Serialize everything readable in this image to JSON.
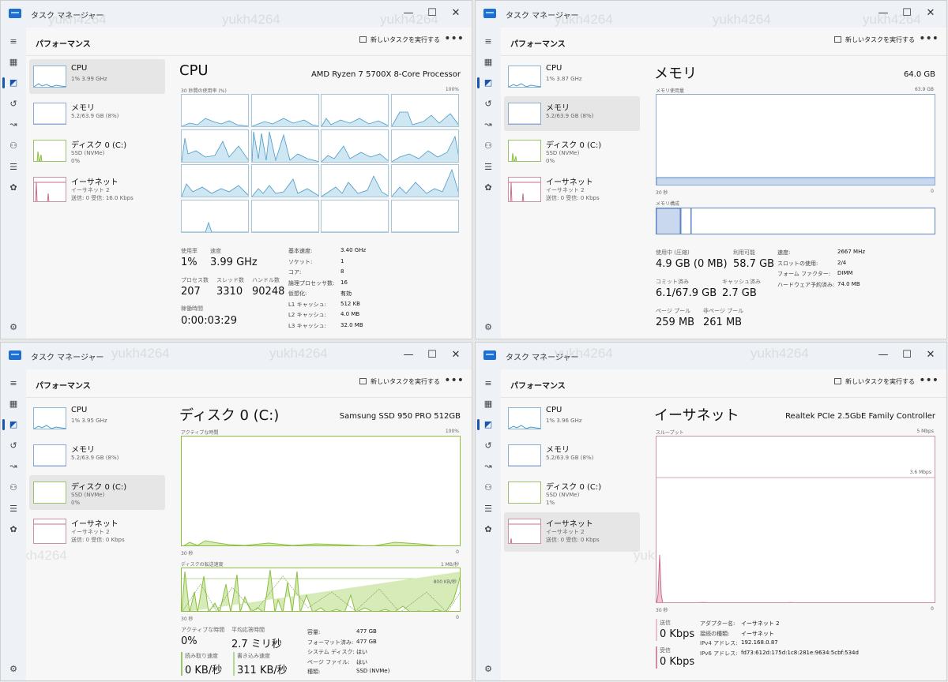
{
  "app_title": "タスク マネージャー",
  "page_title": "パフォーマンス",
  "run_task": "新しいタスクを実行する",
  "more": "•••",
  "window_controls": {
    "min": "—",
    "max": "☐",
    "close": "✕"
  },
  "watermark": "yukh4264",
  "colors": {
    "cpu": "#4a9ac8",
    "mem": "#5c86c4",
    "disk": "#8cbf3e",
    "net": "#c86b8a",
    "accent": "#1a56b0"
  },
  "rail_icons": [
    "hamburger-icon",
    "processes-icon",
    "performance-icon",
    "history-icon",
    "startup-icon",
    "users-icon",
    "details-icon",
    "services-icon",
    "settings-icon"
  ],
  "windows": [
    {
      "sidebar": [
        {
          "name": "CPU",
          "sub1": "1%  3.99 GHz",
          "sub2": "",
          "sub3": ""
        },
        {
          "name": "メモリ",
          "sub1": "5.2/63.9 GB (8%)",
          "sub2": "",
          "sub3": ""
        },
        {
          "name": "ディスク 0 (C:)",
          "sub1": "SSD (NVMe)",
          "sub2": "0%",
          "sub3": ""
        },
        {
          "name": "イーサネット",
          "sub1": "イーサネット 2",
          "sub2": "送信: 0  受信: 16.0 Kbps",
          "sub3": ""
        }
      ],
      "title": "CPU",
      "model": "AMD Ryzen 7 5700X 8-Core Processor",
      "graph_caption_left": "30 秒間の使用率 (%)",
      "graph_caption_right": "100%",
      "stats": {
        "usage_label": "使用率",
        "usage": "1%",
        "speed_label": "速度",
        "speed": "3.99 GHz",
        "proc_label": "プロセス数",
        "proc": "207",
        "thread_label": "スレッド数",
        "thread": "3310",
        "handle_label": "ハンドル数",
        "handle": "90248",
        "uptime_label": "稼働時間",
        "uptime": "0:00:03:29"
      },
      "kv": [
        {
          "k": "基本速度:",
          "v": "3.40 GHz"
        },
        {
          "k": "ソケット:",
          "v": "1"
        },
        {
          "k": "コア:",
          "v": "8"
        },
        {
          "k": "論理プロセッサ数:",
          "v": "16"
        },
        {
          "k": "仮想化:",
          "v": "有効"
        },
        {
          "k": "L1 キャッシュ:",
          "v": "512 KB"
        },
        {
          "k": "L2 キャッシュ:",
          "v": "4.0 MB"
        },
        {
          "k": "L3 キャッシュ:",
          "v": "32.0 MB"
        }
      ]
    },
    {
      "sidebar": [
        {
          "name": "CPU",
          "sub1": "1%  3.87 GHz",
          "sub2": "",
          "sub3": ""
        },
        {
          "name": "メモリ",
          "sub1": "5.2/63.9 GB (8%)",
          "sub2": "",
          "sub3": ""
        },
        {
          "name": "ディスク 0 (C:)",
          "sub1": "SSD (NVMe)",
          "sub2": "0%",
          "sub3": ""
        },
        {
          "name": "イーサネット",
          "sub1": "イーサネット 2",
          "sub2": "送信: 0  受信: 0 Kbps",
          "sub3": ""
        }
      ],
      "title": "メモリ",
      "model": "64.0 GB",
      "graph_caption_left": "メモリ使用量",
      "graph_caption_right": "63.9 GB",
      "axis_left": "30 秒",
      "axis_right": "0",
      "composition_label": "メモリ構成",
      "stats": {
        "inuse_label": "使用中 (圧縮)",
        "inuse": "4.9 GB (0 MB)",
        "avail_label": "利用可能",
        "avail": "58.7 GB",
        "commit_label": "コミット済み",
        "commit": "6.1/67.9 GB",
        "cached_label": "キャッシュ済み",
        "cached": "2.7 GB",
        "paged_label": "ページ プール",
        "paged": "259 MB",
        "nonpaged_label": "非ページ プール",
        "nonpaged": "261 MB"
      },
      "kv": [
        {
          "k": "速度:",
          "v": "2667 MHz"
        },
        {
          "k": "スロットの使用:",
          "v": "2/4"
        },
        {
          "k": "フォーム ファクター:",
          "v": "DIMM"
        },
        {
          "k": "ハードウェア予約済み:",
          "v": "74.0 MB"
        }
      ]
    },
    {
      "sidebar": [
        {
          "name": "CPU",
          "sub1": "1%  3.95 GHz",
          "sub2": "",
          "sub3": ""
        },
        {
          "name": "メモリ",
          "sub1": "5.2/63.9 GB (8%)",
          "sub2": "",
          "sub3": ""
        },
        {
          "name": "ディスク 0 (C:)",
          "sub1": "SSD (NVMe)",
          "sub2": "0%",
          "sub3": ""
        },
        {
          "name": "イーサネット",
          "sub1": "イーサネット 2",
          "sub2": "送信: 0  受信: 0 Kbps",
          "sub3": ""
        }
      ],
      "title": "ディスク 0 (C:)",
      "model": "Samsung SSD 950 PRO 512GB",
      "graph_caption_left": "アクティブな時間",
      "graph_caption_right": "100%",
      "axis_left": "30 秒",
      "axis_right": "0",
      "rate_caption_left": "ディスクの転送速度",
      "rate_caption_right": "1 MB/秒",
      "rate_mid": "800 KB/秒",
      "stats": {
        "active_label": "アクティブな時間",
        "active": "0%",
        "resp_label": "平均応答時間",
        "resp": "2.7 ミリ秒",
        "read_label": "読み取り速度",
        "read": "0 KB/秒",
        "write_label": "書き込み速度",
        "write": "311 KB/秒"
      },
      "kv": [
        {
          "k": "容量:",
          "v": "477 GB"
        },
        {
          "k": "フォーマット済み:",
          "v": "477 GB"
        },
        {
          "k": "システム ディスク:",
          "v": "はい"
        },
        {
          "k": "ページ ファイル:",
          "v": "はい"
        },
        {
          "k": "種類:",
          "v": "SSD (NVMe)"
        }
      ]
    },
    {
      "sidebar": [
        {
          "name": "CPU",
          "sub1": "1%  3.96 GHz",
          "sub2": "",
          "sub3": ""
        },
        {
          "name": "メモリ",
          "sub1": "5.2/63.9 GB (8%)",
          "sub2": "",
          "sub3": ""
        },
        {
          "name": "ディスク 0 (C:)",
          "sub1": "SSD (NVMe)",
          "sub2": "1%",
          "sub3": ""
        },
        {
          "name": "イーサネット",
          "sub1": "イーサネット 2",
          "sub2": "送信: 0  受信: 0 Kbps",
          "sub3": ""
        }
      ],
      "title": "イーサネット",
      "model": "Realtek PCIe 2.5GbE Family Controller",
      "graph_caption_left": "スループット",
      "graph_caption_right": "5 Mbps",
      "graph_mid": "3.6 Mbps",
      "axis_left": "30 秒",
      "axis_right": "0",
      "stats": {
        "send_label": "送信",
        "send": "0 Kbps",
        "recv_label": "受信",
        "recv": "0 Kbps"
      },
      "kv": [
        {
          "k": "アダプター名:",
          "v": "イーサネット 2"
        },
        {
          "k": "接続の種類:",
          "v": "イーサネット"
        },
        {
          "k": "IPv4 アドレス:",
          "v": "192.168.0.87"
        },
        {
          "k": "IPv6 アドレス:",
          "v": "fd73:612d:175d:1c8:281e:9634:5cbf:534d"
        }
      ]
    }
  ]
}
